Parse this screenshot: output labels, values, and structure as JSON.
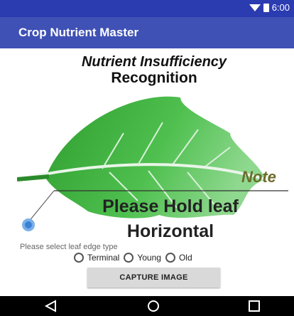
{
  "status_bar": {
    "time": "6:00"
  },
  "app_bar": {
    "title": "Crop Nutrient Master"
  },
  "main": {
    "title_line1": "Nutrient Insufficiency",
    "title_line2": "Recognition",
    "note_label": "Note",
    "instruction_line1": "Please Hold leaf",
    "instruction_line2": "Horizontal"
  },
  "leaf_edge": {
    "label": "Please select leaf edge type",
    "options": [
      {
        "label": "Terminal",
        "selected": false
      },
      {
        "label": "Young",
        "selected": false
      },
      {
        "label": "Old",
        "selected": false
      }
    ]
  },
  "capture_button": {
    "label": "CAPTURE IMAGE"
  },
  "colors": {
    "status_bar": "#2b3bb0",
    "app_bar": "#3f51b5",
    "leaf_green": "#3fb93f",
    "button_bg": "#d9d9d9"
  }
}
